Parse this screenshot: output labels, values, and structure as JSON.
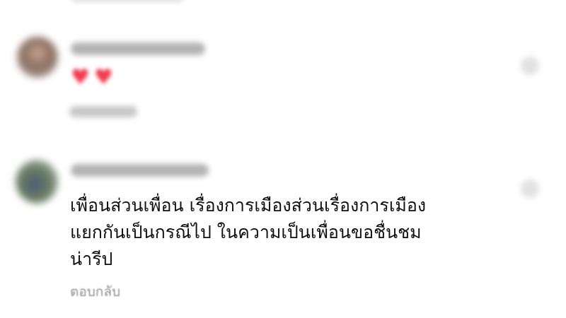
{
  "comments": [
    {
      "reactions": "♥♥",
      "reply_label": "ตอบกลับ"
    },
    {
      "text": "เพื่อนส่วนเพื่อน เรื่องการเมืองส่วนเรื่องการเมือง\nแยกกันเป็นกรณีไป ในความเป็นเพื่อนขอชื่นชม\nน่ารีป",
      "reply_label": "ตอบกลับ"
    }
  ],
  "icons": {
    "like": "heart-outline-icon"
  },
  "colors": {
    "reaction": "#f23b4f",
    "reply_text": "#8e8e8e",
    "comment_text": "#101010"
  }
}
